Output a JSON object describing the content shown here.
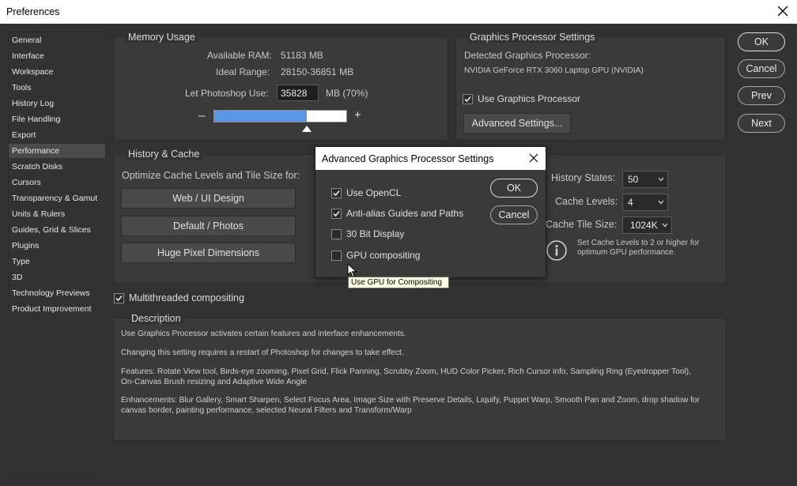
{
  "window": {
    "title": "Preferences"
  },
  "sidebar": {
    "items": [
      {
        "label": "General"
      },
      {
        "label": "Interface"
      },
      {
        "label": "Workspace"
      },
      {
        "label": "Tools"
      },
      {
        "label": "History Log"
      },
      {
        "label": "File Handling"
      },
      {
        "label": "Export"
      },
      {
        "label": "Performance",
        "selected": true
      },
      {
        "label": "Scratch Disks"
      },
      {
        "label": "Cursors"
      },
      {
        "label": "Transparency & Gamut"
      },
      {
        "label": "Units & Rulers"
      },
      {
        "label": "Guides, Grid & Slices"
      },
      {
        "label": "Plugins"
      },
      {
        "label": "Type"
      },
      {
        "label": "3D"
      },
      {
        "label": "Technology Previews"
      },
      {
        "label": "Product Improvement"
      }
    ]
  },
  "memory": {
    "title": "Memory Usage",
    "available_label": "Available RAM:",
    "available_value": "51183 MB",
    "ideal_label": "Ideal Range:",
    "ideal_value": "28150-36851 MB",
    "let_label": "Let Photoshop Use:",
    "let_value": "35828",
    "let_unit": "MB (70%)",
    "slider_fraction": 0.7,
    "minus": "–",
    "plus": "+"
  },
  "gpu": {
    "title": "Graphics Processor Settings",
    "detected_label": "Detected Graphics Processor:",
    "detected_value": "NVIDIA GeForce RTX 3060 Laptop GPU (NVIDIA)",
    "use_label": "Use Graphics Processor",
    "use_checked": true,
    "advanced_button": "Advanced Settings..."
  },
  "history": {
    "title": "History & Cache",
    "optimize_label": "Optimize Cache Levels and Tile Size for:",
    "buttons": [
      "Web / UI Design",
      "Default / Photos",
      "Huge Pixel Dimensions"
    ],
    "states_label": "History States:",
    "states_value": "50",
    "levels_label": "Cache Levels:",
    "levels_value": "4",
    "tile_label": "Cache Tile Size:",
    "tile_value": "1024K",
    "info_text": "Set Cache Levels to 2 or higher for optimum GPU performance."
  },
  "multithreaded": {
    "label": "Multithreaded compositing",
    "checked": true
  },
  "description": {
    "title": "Description",
    "lines": [
      "Use Graphics Processor activates certain features and interface enhancements.",
      "Changing this setting requires a restart of Photoshop for changes to take effect.",
      "Features: Rotate View tool, Birds-eye zooming, Pixel Grid, Flick Panning, Scrubby Zoom, HUD Color Picker, Rich Cursor info, Sampling Ring (Eyedropper Tool), On-Canvas Brush resizing and Adaptive Wide Angle",
      "Enhancements: Blur Gallery, Smart Sharpen, Select Focus Area, Image Size with Preserve Details, Liquify, Puppet Warp, Smooth Pan and Zoom, drop shadow for canvas border, painting performance, selected Neural Filters and Transform/Warp"
    ]
  },
  "buttons": {
    "ok": "OK",
    "cancel": "Cancel",
    "prev": "Prev",
    "next": "Next"
  },
  "dialog": {
    "title": "Advanced Graphics Processor Settings",
    "options": [
      {
        "label": "Use OpenCL",
        "checked": true
      },
      {
        "label": "Anti-alias Guides and Paths",
        "checked": true
      },
      {
        "label": "30 Bit Display",
        "checked": false
      },
      {
        "label": "GPU compositing",
        "checked": false
      }
    ],
    "ok": "OK",
    "cancel": "Cancel"
  },
  "tooltip": {
    "text": "Use GPU for Compositing"
  },
  "colors": {
    "accent": "#5a96e6",
    "window_bg": "#323232",
    "panel_bg": "#3a3a3a"
  }
}
